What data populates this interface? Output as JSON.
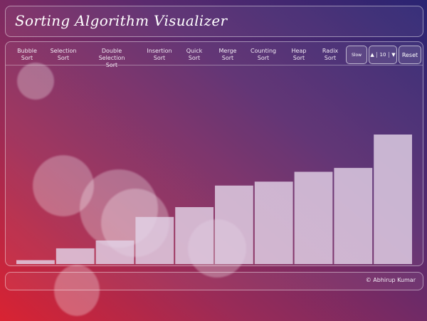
{
  "header": {
    "title": "Sorting Algorithm Visualizer"
  },
  "nav": {
    "algorithms": [
      {
        "line1": "Bubble",
        "line2": "Sort"
      },
      {
        "line1": "Selection",
        "line2": "Sort"
      },
      {
        "line1": "Double Selection",
        "line2": "Sort"
      },
      {
        "line1": "Insertion",
        "line2": "Sort"
      },
      {
        "line1": "Quick",
        "line2": "Sort"
      },
      {
        "line1": "Merge",
        "line2": "Sort"
      },
      {
        "line1": "Counting",
        "line2": "Sort"
      },
      {
        "line1": "Heap",
        "line2": "Sort"
      },
      {
        "line1": "Radix",
        "line2": "Sort"
      }
    ],
    "speed_label": "Slow",
    "size_value": "10",
    "size_up_icon": "triangle-up-icon",
    "size_down_icon": "triangle-down-icon",
    "reset_label": "Reset"
  },
  "chart_data": {
    "type": "bar",
    "values": [
      2,
      8,
      12,
      24,
      29,
      40,
      42,
      47,
      49,
      66
    ],
    "ylim": [
      0,
      66
    ],
    "bar_color": "#e2d2e6"
  },
  "footer": {
    "credit": "© Abhirup Kumar"
  },
  "colors": {
    "gradient_start": "#d92332",
    "gradient_end": "#2a2472",
    "panel_border": "#ffffff"
  }
}
